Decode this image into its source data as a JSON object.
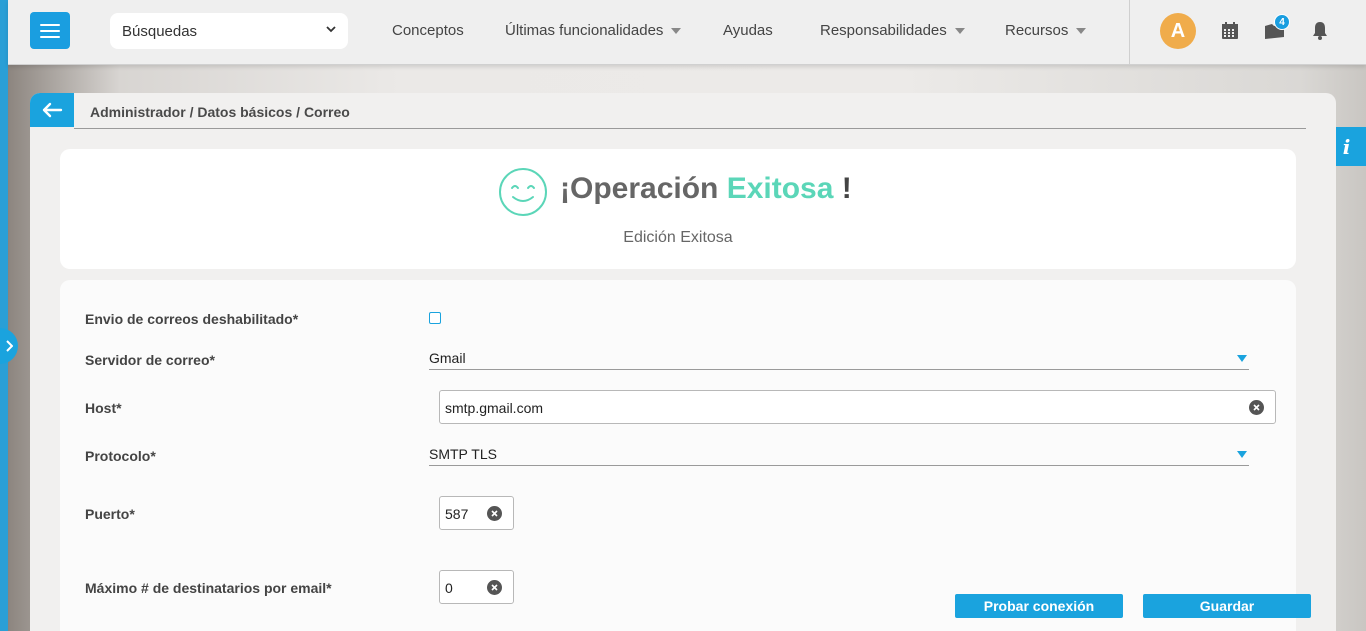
{
  "header": {
    "search_select": "Búsquedas",
    "nav": [
      {
        "label": "Conceptos",
        "has_caret": false
      },
      {
        "label": "Últimas funcionalidades",
        "has_caret": true
      },
      {
        "label": "Ayudas",
        "has_caret": false
      },
      {
        "label": "Responsabilidades",
        "has_caret": true
      },
      {
        "label": "Recursos",
        "has_caret": true
      }
    ],
    "avatar_initial": "A",
    "notifications_badge": "4",
    "icons": [
      "menu-icon",
      "chevron-down-icon",
      "calendar-icon",
      "folder-icon",
      "bell-icon"
    ]
  },
  "breadcrumb": "Administrador / Datos básicos / Correo",
  "info_label": "i",
  "success": {
    "title_prefix": "¡Operación ",
    "title_accent": "Exitosa",
    "title_suffix": " !",
    "subtitle": "Edición Exitosa"
  },
  "form": {
    "disabled_label": "Envio de correos deshabilitado*",
    "disabled_checked": false,
    "server_label": "Servidor de correo*",
    "server_value": "Gmail",
    "host_label": "Host*",
    "host_value": "smtp.gmail.com",
    "protocol_label": "Protocolo*",
    "protocol_value": "SMTP TLS",
    "port_label": "Puerto*",
    "port_value": "587",
    "max_label": "Máximo # de destinatarios por email*",
    "max_value": "0"
  },
  "actions": {
    "test": "Probar conexión",
    "save": "Guardar"
  },
  "colors": {
    "primary": "#1aa3de",
    "accent": "#5bd6b8",
    "avatar": "#f0ac4b"
  }
}
